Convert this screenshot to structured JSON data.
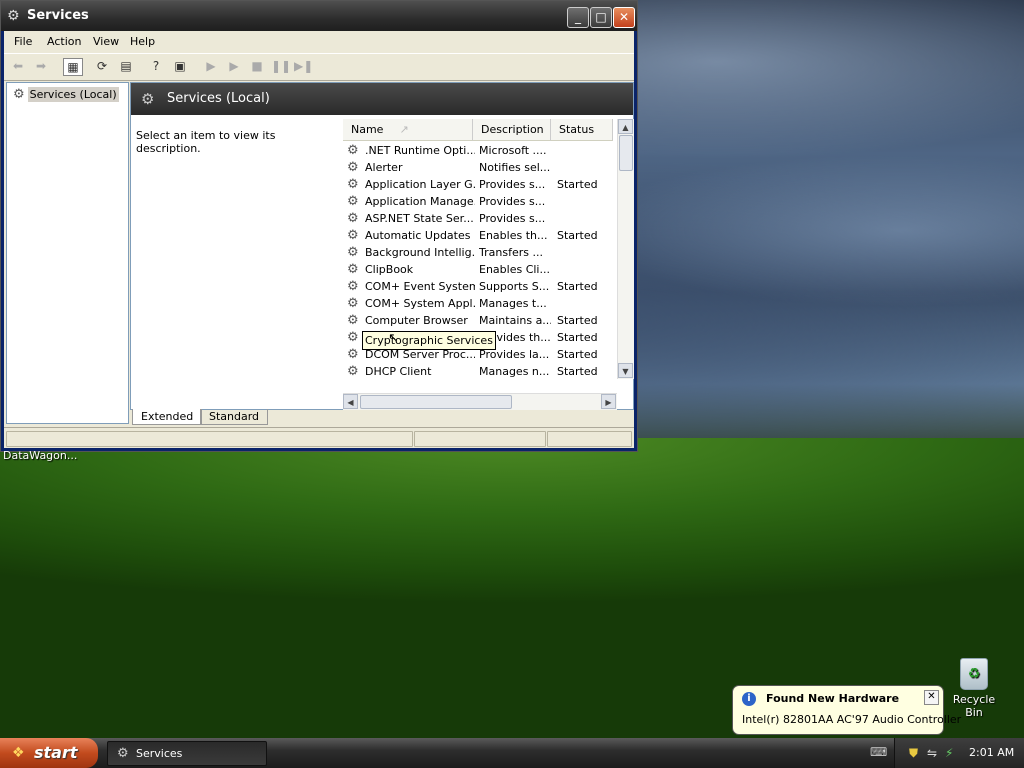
{
  "window": {
    "title": "Services",
    "controls": {
      "minimize": "_",
      "maximize": "□",
      "close": "✕"
    }
  },
  "menu": [
    "File",
    "Action",
    "View",
    "Help"
  ],
  "tree": {
    "root": "Services (Local)"
  },
  "pane": {
    "header": "Services (Local)",
    "description_prompt": "Select an item to view its description."
  },
  "columns": [
    "Name",
    "Description",
    "Status"
  ],
  "services": [
    {
      "name": ".NET Runtime Opti...",
      "desc": "Microsoft ....",
      "status": ""
    },
    {
      "name": "Alerter",
      "desc": "Notifies sel...",
      "status": ""
    },
    {
      "name": "Application Layer G...",
      "desc": "Provides s...",
      "status": "Started"
    },
    {
      "name": "Application Manage...",
      "desc": "Provides s...",
      "status": ""
    },
    {
      "name": "ASP.NET State Ser...",
      "desc": "Provides s...",
      "status": ""
    },
    {
      "name": "Automatic Updates",
      "desc": "Enables th...",
      "status": "Started"
    },
    {
      "name": "Background Intellig...",
      "desc": "Transfers ...",
      "status": ""
    },
    {
      "name": "ClipBook",
      "desc": "Enables Cli...",
      "status": ""
    },
    {
      "name": "COM+ Event System",
      "desc": "Supports S...",
      "status": "Started"
    },
    {
      "name": "COM+ System Appl...",
      "desc": "Manages t...",
      "status": ""
    },
    {
      "name": "Computer Browser",
      "desc": "Maintains a...",
      "status": "Started"
    },
    {
      "name": "",
      "desc": "Provides th...",
      "status": "Started"
    },
    {
      "name": "DCOM Server Proc...",
      "desc": "Provides la...",
      "status": "Started"
    },
    {
      "name": "DHCP Client",
      "desc": "Manages n...",
      "status": "Started"
    }
  ],
  "tooltip": "Cryptographic Services",
  "tabs": [
    "Extended",
    "Standard"
  ],
  "desktop": {
    "partial_label": "DataWagon...",
    "recycle_bin": "Recycle Bin"
  },
  "balloon": {
    "title": "Found New Hardware",
    "message": "Intel(r) 82801AA AC'97 Audio Controller"
  },
  "taskbar": {
    "start": "start",
    "task": "Services",
    "clock": "2:01 AM"
  }
}
